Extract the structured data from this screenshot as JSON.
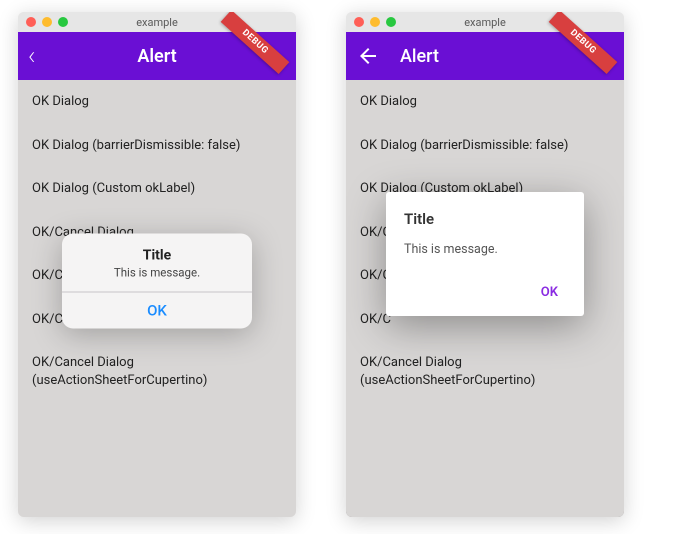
{
  "windowTitle": "example",
  "debugBadge": "DEBUG",
  "appbar": {
    "title": "Alert"
  },
  "list": {
    "items": [
      "OK Dialog",
      "OK Dialog (barrierDismissible: false)",
      "OK Dialog (Custom okLabel)",
      "OK/Cancel Dialog",
      "OK/Cancel Dialog (Custom Label)",
      "OK/Cancel Dialog (cancel)",
      "OK/Cancel Dialog (useActionSheetForCupertino)"
    ],
    "visibleLeftTruncated": {
      "4": "OK/C",
      "5": "OK/C"
    },
    "visibleRightTruncated": {
      "4": "OK/C",
      "5": "OK/C"
    }
  },
  "cupertinoAlert": {
    "title": "Title",
    "message": "This is message.",
    "ok": "OK"
  },
  "materialAlert": {
    "title": "Title",
    "message": "This is message.",
    "ok": "OK"
  }
}
